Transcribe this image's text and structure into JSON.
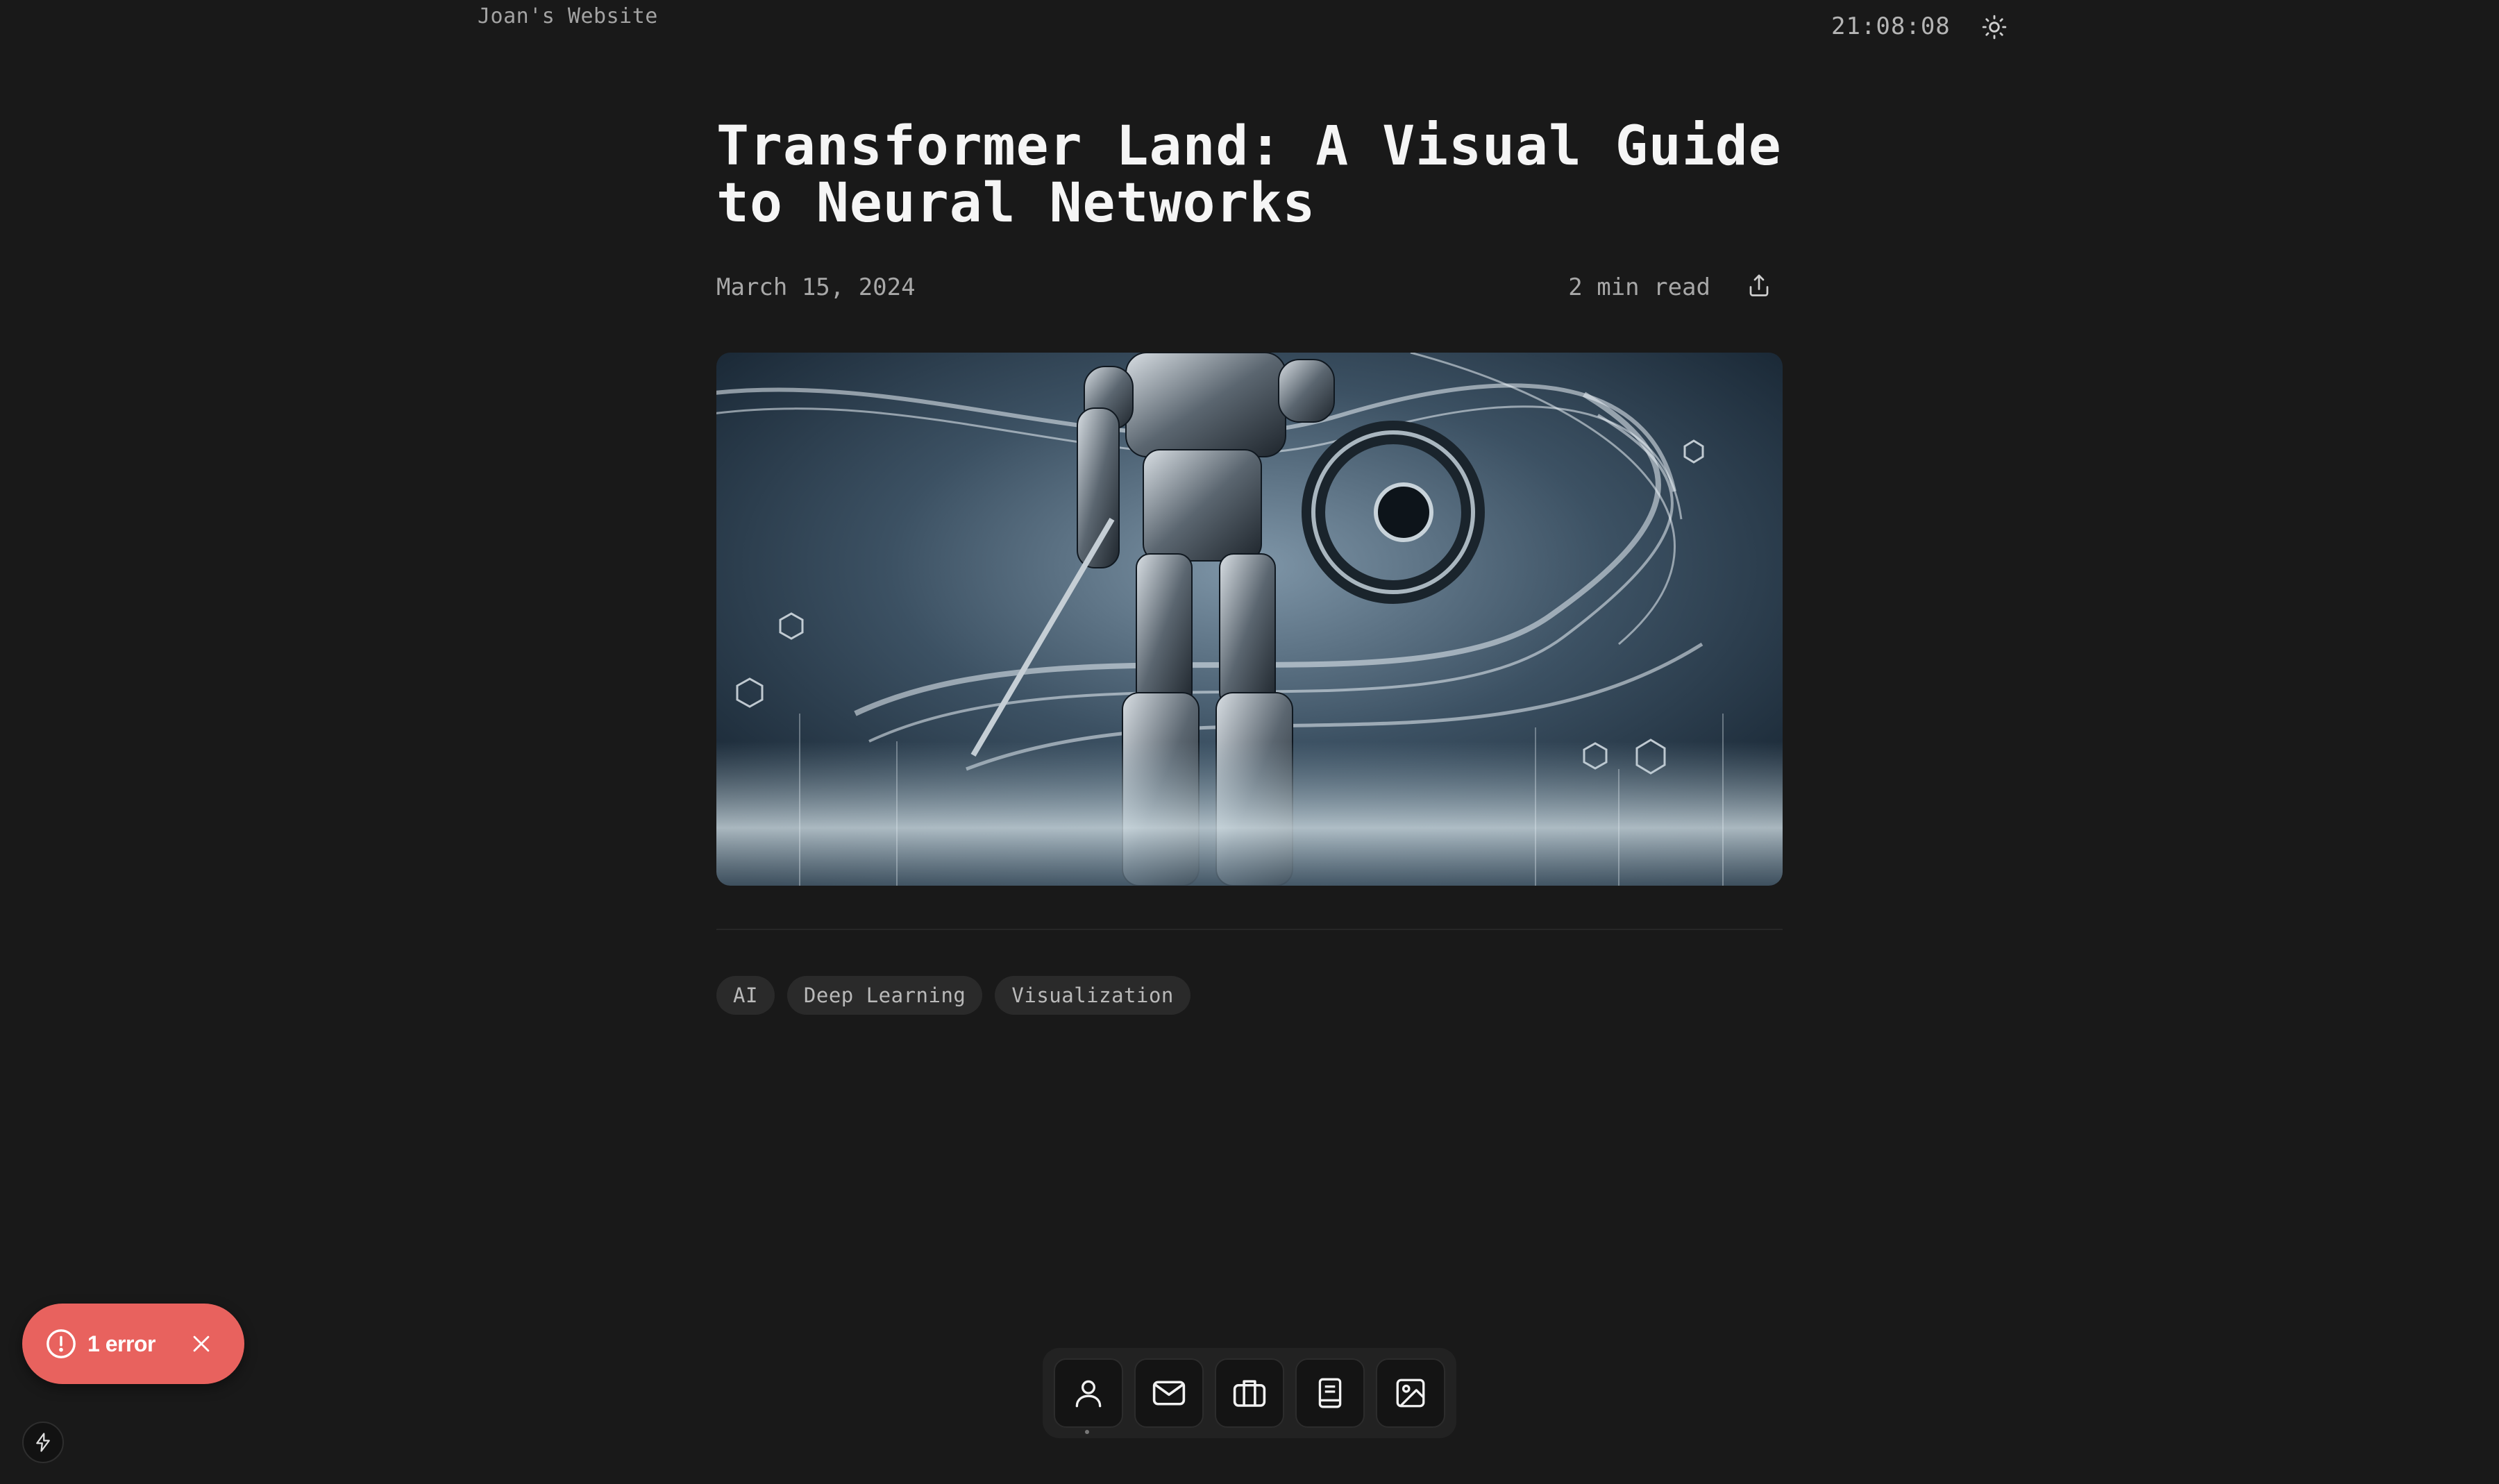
{
  "header": {
    "site_name": "Joan's Website",
    "clock": "21:08:08",
    "theme_toggle_icon": "sun-icon"
  },
  "article": {
    "title": "Transformer Land: A Visual Guide to Neural Networks",
    "date": "March 15, 2024",
    "read_time": "2 min read",
    "share_icon": "share-icon",
    "hero_image": "robot-neural-network-illustration",
    "tags": [
      "AI",
      "Deep Learning",
      "Visualization"
    ]
  },
  "error_toast": {
    "label": "1 error",
    "color": "#e8625e"
  },
  "dock": {
    "items": [
      {
        "icon": "person-icon",
        "active": true
      },
      {
        "icon": "mail-icon"
      },
      {
        "icon": "briefcase-icon"
      },
      {
        "icon": "document-icon"
      },
      {
        "icon": "image-icon"
      }
    ]
  },
  "colors": {
    "background": "#191919",
    "text": "#f5f5f5",
    "muted": "#a8a8a8",
    "tag_bg": "#2a2a2a"
  }
}
